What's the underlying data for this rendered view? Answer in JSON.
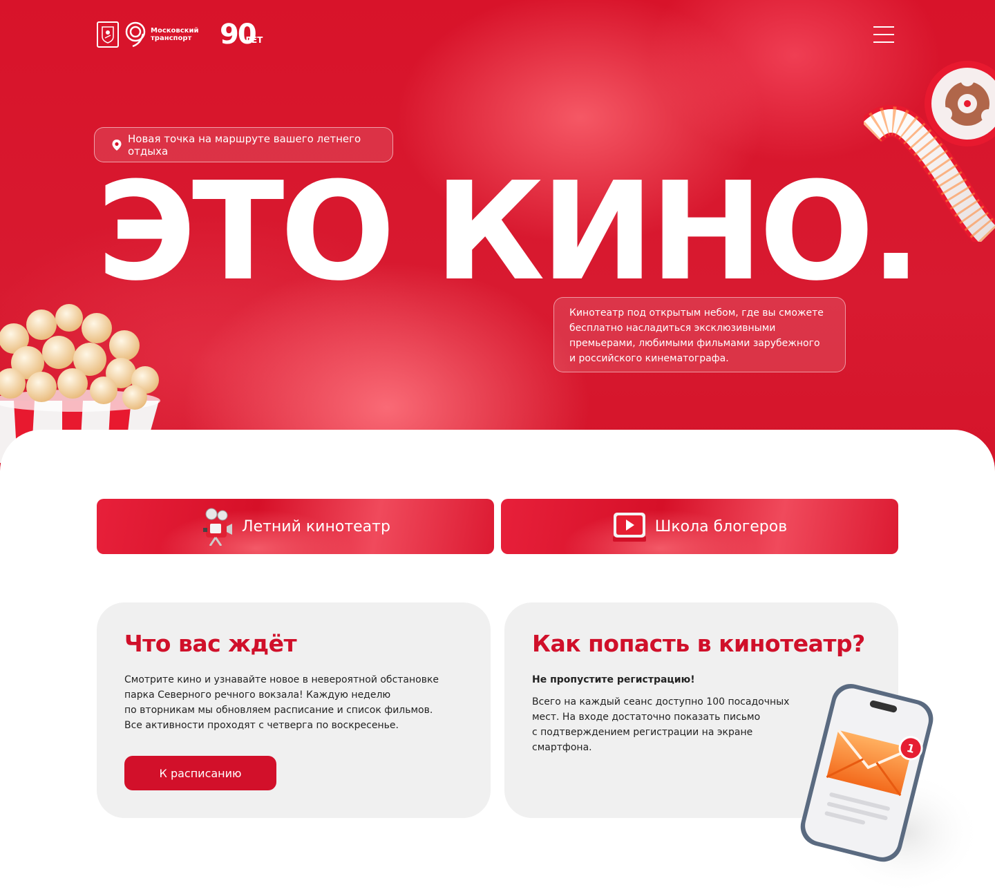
{
  "header": {
    "logo_transport_line1": "Московский",
    "logo_transport_line2": "транспорт",
    "logo_anniversary_number": "90",
    "logo_anniversary_word": "ЛЕТ"
  },
  "hero": {
    "route_pill": "Новая точка на маршруте вашего летнего отдыха",
    "title": "ЭТО КИНО.",
    "description_lines": [
      "Кинотеатр под открытым небом, где вы сможете",
      "бесплатно насладиться эксклюзивными",
      "премьерами, любимыми фильмами зарубежного",
      "и российского кинематографа."
    ]
  },
  "tabs": [
    {
      "label": "Летний кинотеатр",
      "icon": "film-camera-icon"
    },
    {
      "label": "Школа блогеров",
      "icon": "video-play-icon"
    }
  ],
  "cards": {
    "what_awaits": {
      "title": "Что вас ждёт",
      "lines": [
        "Смотрите кино и узнавайте новое в невероятной обстановке",
        "парка Северного речного вокзала! Каждую неделю",
        "по вторникам мы обновляем расписание и список фильмов.",
        "Все активности проходят с четверга по воскресенье."
      ],
      "button_label": "К расписанию"
    },
    "how_to_get": {
      "title": "Как попасть в кинотеатр?",
      "subtitle": "Не пропустите регистрацию!",
      "lines": [
        "Всего на каждый сеанс доступно 100 посадочных",
        "мест. На входе достаточно показать письмо",
        "с подтверждением регистрации на экране",
        "смартфона."
      ],
      "notification_count": "1"
    }
  },
  "colors": {
    "brand_red": "#d2102a",
    "card_bg": "#f0f0f0",
    "text_dark": "#222222"
  }
}
